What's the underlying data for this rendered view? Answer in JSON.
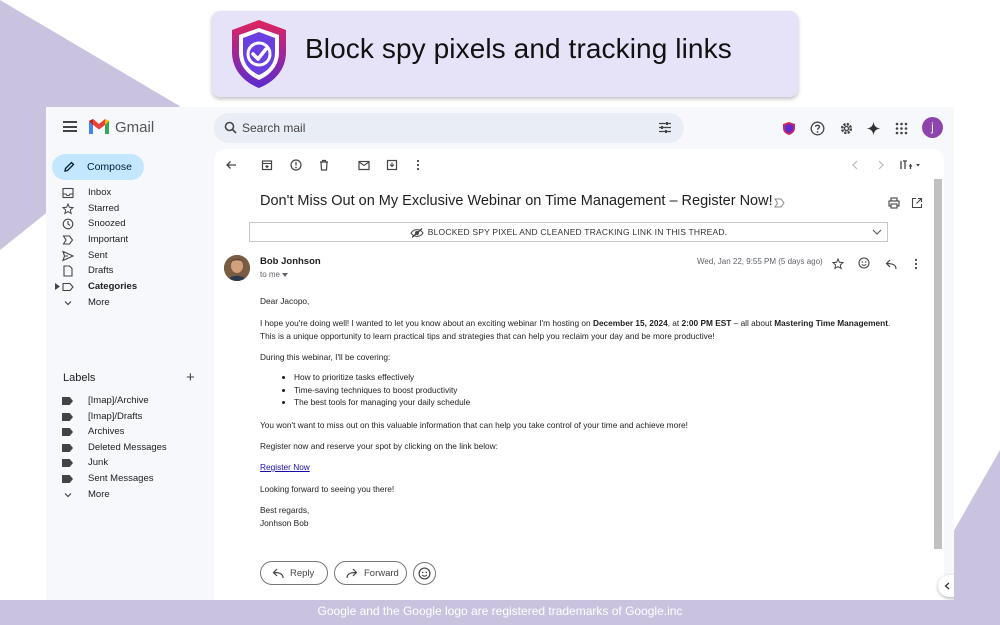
{
  "banner": {
    "headline": "Block spy pixels and tracking links"
  },
  "colors": {
    "accent": "#6c3bd6",
    "compose_bg": "#c2e7ff",
    "avatar": "#8e44ad",
    "link": "#1a0dab"
  },
  "app": {
    "logo": "Gmail"
  },
  "search": {
    "placeholder": "Search mail"
  },
  "account": {
    "initial": "j"
  },
  "sidebar": {
    "compose": "Compose",
    "items": [
      "Inbox",
      "Starred",
      "Snoozed",
      "Important",
      "Sent",
      "Drafts",
      "Categories",
      "More"
    ],
    "labels_title": "Labels",
    "labels": [
      "[Imap]/Archive",
      "[Imap]/Drafts",
      "Archives",
      "Deleted Messages",
      "Junk",
      "Sent Messages",
      "More"
    ]
  },
  "email": {
    "subject": "Don't Miss Out on My Exclusive Webinar on Time Management – Register Now!",
    "notice": "BLOCKED SPY PIXEL AND CLEANED TRACKING LINK IN THIS THREAD.",
    "sender": "Bob Jonhson",
    "to": "to me",
    "date": "Wed, Jan 22, 9:55 PM (5 days ago)",
    "greeting": "Dear Jacopo,",
    "p1_a": "I hope you're doing well! I wanted to let you know about an exciting webinar I'm hosting on ",
    "p1_date": "December 15, 2024",
    "p1_b": ", at ",
    "p1_time": "2:00 PM EST",
    "p1_c": " – all about ",
    "p1_topic": "Mastering Time Management",
    "p1_d": ".",
    "p1_line2": "This is a unique opportunity to learn practical tips and strategies that can help you reclaim your day and be more productive!",
    "p2": "During this webinar, I'll be covering:",
    "bullets": [
      "How to prioritize tasks effectively",
      "Time-saving techniques to boost productivity",
      "The best tools for managing your daily schedule"
    ],
    "p3": "You won't want to miss out on this valuable information that can help you take control of your time and achieve more!",
    "p4": "Register now and reserve your spot by clicking on the link below:",
    "link": "Register Now",
    "p5": "Looking forward to seeing you there!",
    "sign1": "Best regards,",
    "sign2": "Jonhson Bob"
  },
  "actions": {
    "reply": "Reply",
    "forward": "Forward"
  },
  "footer": "Google and the Google logo are registered trademarks of Google.inc"
}
